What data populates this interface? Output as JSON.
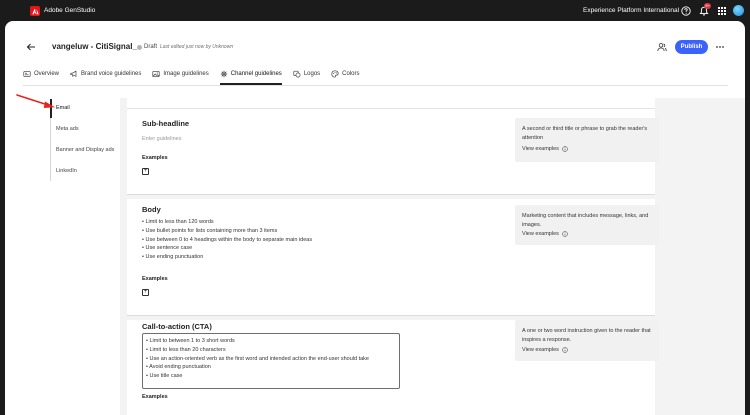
{
  "topbar": {
    "app_name": "Adobe GenStudio",
    "org_name": "Experience Platform International",
    "notification_count": "9+"
  },
  "header": {
    "title": "vangeluw - CitiSignal_",
    "status": "Draft",
    "last_edited": "Last edited just now by Unknown",
    "publish_label": "Publish"
  },
  "tabs": [
    {
      "label": "Overview",
      "icon": "overview-icon"
    },
    {
      "label": "Brand voice guidelines",
      "icon": "megaphone-icon"
    },
    {
      "label": "Image guidelines",
      "icon": "image-icon"
    },
    {
      "label": "Channel guidelines",
      "icon": "channel-icon",
      "active": true
    },
    {
      "label": "Logos",
      "icon": "logo-icon"
    },
    {
      "label": "Colors",
      "icon": "palette-icon"
    }
  ],
  "sidenav": {
    "items": [
      "Email",
      "Meta ads",
      "Banner and Display ads",
      "LinkedIn"
    ],
    "active": "Email"
  },
  "sections": [
    {
      "title": "Sub-headline",
      "placeholder": "Enter guidelines",
      "examples_label": "Examples",
      "info": "A second or third title or phrase to grab the reader's attention",
      "view_examples": "View examples"
    },
    {
      "title": "Body",
      "rules": [
        "Limit to less than 120 words",
        "Use bullet points for lists containing more than 3 items",
        "Use between 0 to 4 headings within the body to separate main ideas",
        "Use sentence case",
        "Use ending punctuation"
      ],
      "examples_label": "Examples",
      "info": "Marketing content that includes message, links, and images.",
      "view_examples": "View examples"
    },
    {
      "title": "Call-to-action (CTA)",
      "rules": [
        "Limit to between 1 to 3 short words",
        "Limit to less than 20 characters",
        "Use an action-oriented verb as the first word and intended action the end-user should take",
        "Avoid ending punctuation",
        "Use title case"
      ],
      "examples_label": "Examples",
      "info": "A one or two word instruction given to the reader that inspires a response.",
      "view_examples": "View examples"
    }
  ],
  "colors": {
    "publish": "#3b63fb",
    "annotation_arrow": "#e8231b",
    "brand_red": "#e8141b"
  }
}
